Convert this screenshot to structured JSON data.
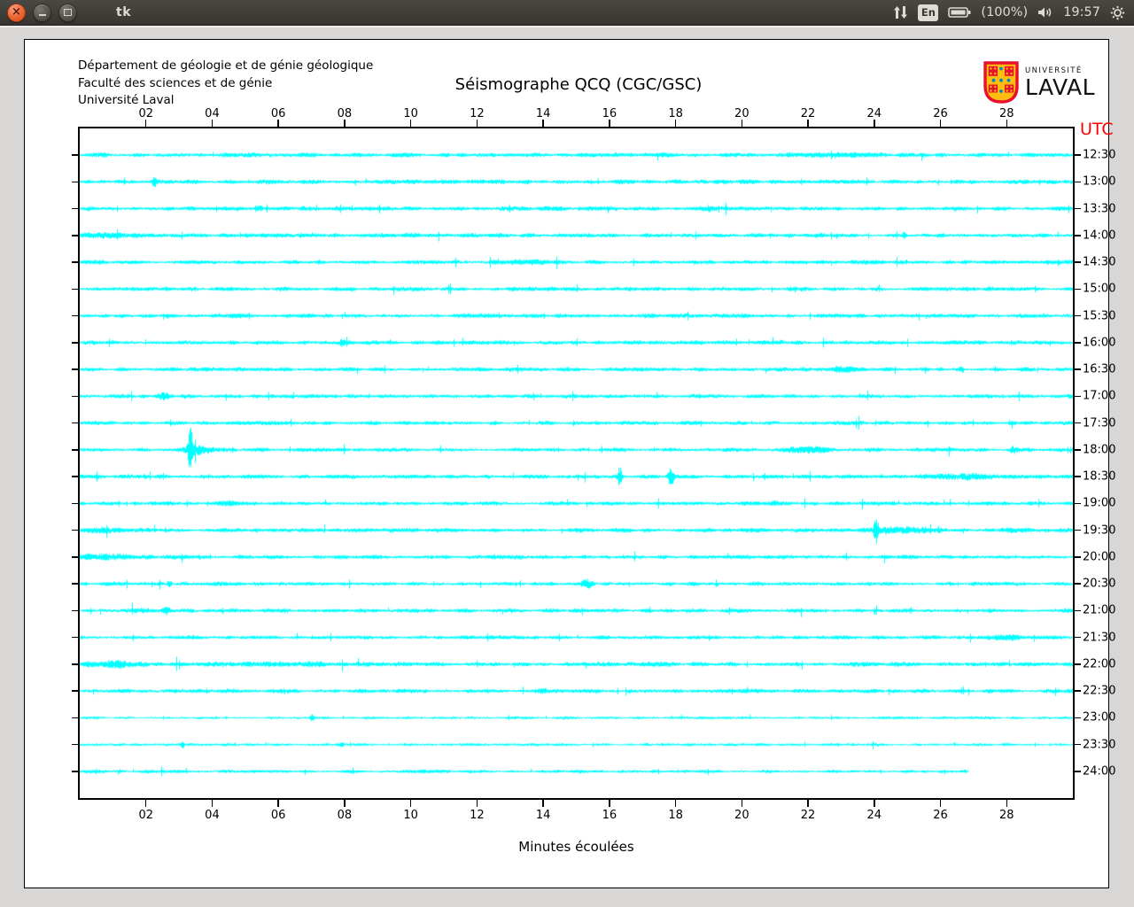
{
  "titlebar": {
    "title": "tk",
    "tray": {
      "keyboard_layout": "En",
      "battery_level": "(100%)",
      "clock": "19:57"
    }
  },
  "header": {
    "left_lines": [
      "Département de géologie et de génie géologique",
      "Faculté des sciences et de génie",
      "Université Laval"
    ],
    "logo": {
      "top": "UNIVERSITÉ",
      "bottom": "LAVAL"
    }
  },
  "chart_data": {
    "type": "line",
    "title": "Séismographe QCQ (CGC/GSC)",
    "xlabel": "Minutes écoulées",
    "right_axis_title": "UTC",
    "x_range_minutes": [
      0,
      30
    ],
    "x_ticks": [
      {
        "m": 2,
        "label": "02"
      },
      {
        "m": 4,
        "label": "04"
      },
      {
        "m": 6,
        "label": "06"
      },
      {
        "m": 8,
        "label": "08"
      },
      {
        "m": 10,
        "label": "10"
      },
      {
        "m": 12,
        "label": "12"
      },
      {
        "m": 14,
        "label": "14"
      },
      {
        "m": 16,
        "label": "16"
      },
      {
        "m": 18,
        "label": "18"
      },
      {
        "m": 20,
        "label": "20"
      },
      {
        "m": 22,
        "label": "22"
      },
      {
        "m": 24,
        "label": "24"
      },
      {
        "m": 26,
        "label": "26"
      },
      {
        "m": 28,
        "label": "28"
      }
    ],
    "trace_color": "#00ffff",
    "axis_color": "#000000",
    "utc_label_color": "#ff0000",
    "minutes_per_row": 30,
    "traces": [
      {
        "utc": "12:30",
        "amp": 2.0,
        "end": 1,
        "events": [
          {
            "m": 22.8,
            "a": 1.2,
            "w": 0.8
          }
        ]
      },
      {
        "utc": "13:00",
        "amp": 2.0,
        "end": 1,
        "events": [
          {
            "m": 2.24,
            "a": 5.0,
            "w": 0.05
          }
        ]
      },
      {
        "utc": "13:30",
        "amp": 2.0,
        "end": 1,
        "events": [
          {
            "m": 5.4,
            "a": 2.5,
            "w": 0.06
          },
          {
            "m": 19.0,
            "a": 2.0,
            "w": 0.08
          }
        ]
      },
      {
        "utc": "14:00",
        "amp": 2.0,
        "end": 1,
        "events": [
          {
            "m": 0.9,
            "a": 1.6,
            "w": 0.5
          },
          {
            "m": 24.9,
            "a": 3.0,
            "w": 0.05
          }
        ]
      },
      {
        "utc": "14:30",
        "amp": 1.9,
        "end": 1,
        "events": [
          {
            "m": 13.5,
            "a": 1.6,
            "w": 0.6
          }
        ]
      },
      {
        "utc": "15:00",
        "amp": 1.9,
        "end": 1,
        "events": []
      },
      {
        "utc": "15:30",
        "amp": 1.9,
        "end": 1,
        "events": [
          {
            "m": 4.7,
            "a": 1.4,
            "w": 0.4
          }
        ]
      },
      {
        "utc": "16:00",
        "amp": 1.9,
        "end": 1,
        "events": [
          {
            "m": 7.9,
            "a": 3.0,
            "w": 0.05
          }
        ]
      },
      {
        "utc": "16:30",
        "amp": 1.9,
        "end": 1,
        "events": [
          {
            "m": 23.1,
            "a": 2.0,
            "w": 0.3
          },
          {
            "m": 26.6,
            "a": 3.5,
            "w": 0.07
          }
        ]
      },
      {
        "utc": "17:00",
        "amp": 1.9,
        "end": 1,
        "events": [
          {
            "m": 2.5,
            "a": 2.8,
            "w": 0.15
          }
        ]
      },
      {
        "utc": "17:30",
        "amp": 1.8,
        "end": 1,
        "events": []
      },
      {
        "utc": "18:00",
        "amp": 1.8,
        "end": 1,
        "events": [
          {
            "m": 3.33,
            "a": 25.0,
            "w": 0.04
          },
          {
            "m": 3.5,
            "a": 5.0,
            "w": 0.3
          },
          {
            "m": 22.0,
            "a": 2.6,
            "w": 0.5
          },
          {
            "m": 28.2,
            "a": 3.0,
            "w": 0.06
          }
        ]
      },
      {
        "utc": "18:30",
        "amp": 1.9,
        "end": 1,
        "events": [
          {
            "m": 16.3,
            "a": 11.0,
            "w": 0.04
          },
          {
            "m": 17.85,
            "a": 12.0,
            "w": 0.05
          },
          {
            "m": 26.5,
            "a": 2.0,
            "w": 0.7
          }
        ]
      },
      {
        "utc": "19:00",
        "amp": 1.8,
        "end": 1,
        "events": [
          {
            "m": 4.5,
            "a": 1.5,
            "w": 0.3
          },
          {
            "m": 21.0,
            "a": 1.6,
            "w": 0.2
          }
        ]
      },
      {
        "utc": "19:30",
        "amp": 1.9,
        "end": 1,
        "events": [
          {
            "m": 0.8,
            "a": 2.0,
            "w": 0.4
          },
          {
            "m": 24.05,
            "a": 13.0,
            "w": 0.05
          },
          {
            "m": 24.8,
            "a": 2.2,
            "w": 0.7
          },
          {
            "m": 28.1,
            "a": 2.0,
            "w": 0.2
          }
        ]
      },
      {
        "utc": "20:00",
        "amp": 1.9,
        "end": 1,
        "events": [
          {
            "m": 0.8,
            "a": 2.2,
            "w": 0.6
          },
          {
            "m": 13.0,
            "a": 1.2,
            "w": 0.3
          }
        ]
      },
      {
        "utc": "20:30",
        "amp": 1.8,
        "end": 1,
        "events": [
          {
            "m": 2.7,
            "a": 3.0,
            "w": 0.05
          },
          {
            "m": 15.3,
            "a": 4.5,
            "w": 0.12
          }
        ]
      },
      {
        "utc": "21:00",
        "amp": 1.8,
        "end": 1,
        "events": [
          {
            "m": 2.6,
            "a": 3.2,
            "w": 0.08
          },
          {
            "m": 1.8,
            "a": 1.5,
            "w": 0.4
          }
        ]
      },
      {
        "utc": "21:30",
        "amp": 1.7,
        "end": 1,
        "events": [
          {
            "m": 28.0,
            "a": 1.6,
            "w": 0.5
          }
        ]
      },
      {
        "utc": "22:00",
        "amp": 2.0,
        "end": 1,
        "events": [
          {
            "m": 1.0,
            "a": 2.6,
            "w": 0.5
          },
          {
            "m": 6.0,
            "a": 1.0,
            "w": 1.5
          }
        ]
      },
      {
        "utc": "22:30",
        "amp": 1.8,
        "end": 1,
        "events": [
          {
            "m": 14.0,
            "a": 1.2,
            "w": 0.3
          }
        ]
      },
      {
        "utc": "23:00",
        "amp": 1.2,
        "end": 1,
        "events": [
          {
            "m": 7.0,
            "a": 2.6,
            "w": 0.05
          }
        ]
      },
      {
        "utc": "23:30",
        "amp": 1.2,
        "end": 1,
        "events": [
          {
            "m": 3.1,
            "a": 3.0,
            "w": 0.04
          },
          {
            "m": 7.9,
            "a": 2.6,
            "w": 0.05
          }
        ]
      },
      {
        "utc": "24:00",
        "amp": 1.4,
        "end": 0.895,
        "events": [
          {
            "m": 10.0,
            "a": 1.0,
            "w": 0.3
          }
        ]
      }
    ]
  }
}
